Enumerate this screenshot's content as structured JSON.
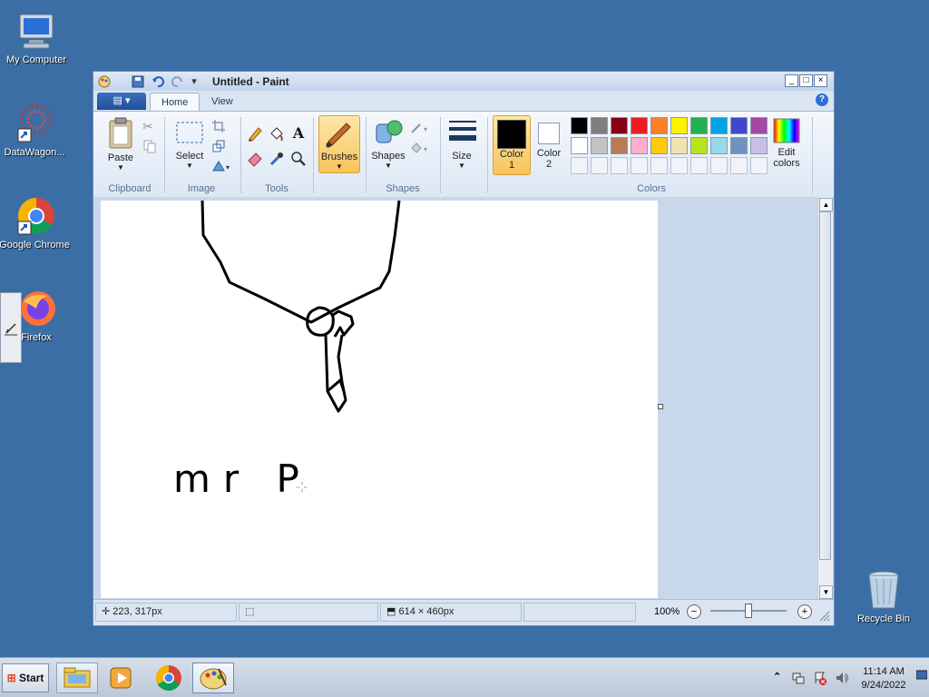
{
  "desktop": {
    "icons": [
      {
        "label": "My Computer"
      },
      {
        "label": "DataWagon..."
      },
      {
        "label": "Google Chrome"
      },
      {
        "label": "Firefox"
      },
      {
        "label": "Recycle Bin"
      }
    ]
  },
  "window": {
    "title": "Untitled - Paint",
    "controls": {
      "minimize": "_",
      "maximize": "□",
      "close": "×"
    },
    "help": "?"
  },
  "tabs": [
    {
      "label": "Home",
      "active": true
    },
    {
      "label": "View",
      "active": false
    }
  ],
  "ribbon": {
    "clipboard": {
      "paste": "Paste",
      "group": "Clipboard"
    },
    "image": {
      "select": "Select",
      "group": "Image"
    },
    "tools": {
      "group": "Tools",
      "text_tool": "A"
    },
    "brushes": {
      "label": "Brushes"
    },
    "shapes": {
      "label": "Shapes",
      "group": "Shapes"
    },
    "size": {
      "label": "Size"
    },
    "color1": {
      "label_line1": "Color",
      "label_line2": "1",
      "color": "#000000"
    },
    "color2": {
      "label_line1": "Color",
      "label_line2": "2",
      "color": "#ffffff"
    },
    "colors_group": "Colors",
    "edit_colors": {
      "line1": "Edit",
      "line2": "colors"
    },
    "palette_row1": [
      "#000000",
      "#7f7f7f",
      "#880015",
      "#ed1c24",
      "#ff7f27",
      "#fff200",
      "#22b14c",
      "#00a2e8",
      "#3f48cc",
      "#a349a4"
    ],
    "palette_row2": [
      "#ffffff",
      "#c3c3c3",
      "#b97a57",
      "#ffaec9",
      "#ffc90e",
      "#efe4b0",
      "#b5e61d",
      "#99d9ea",
      "#7092be",
      "#c8bfe7"
    ]
  },
  "canvas": {
    "text": "mr P"
  },
  "status": {
    "cursor_pos": "223, 317px",
    "image_size": "614 × 460px",
    "zoom": "100%",
    "zoom_minus": "−",
    "zoom_plus": "+",
    "zoom_level": 0.5
  },
  "taskbar": {
    "start": "Start",
    "time": "11:14 AM",
    "date": "9/24/2022",
    "tray_up": "⌃"
  }
}
